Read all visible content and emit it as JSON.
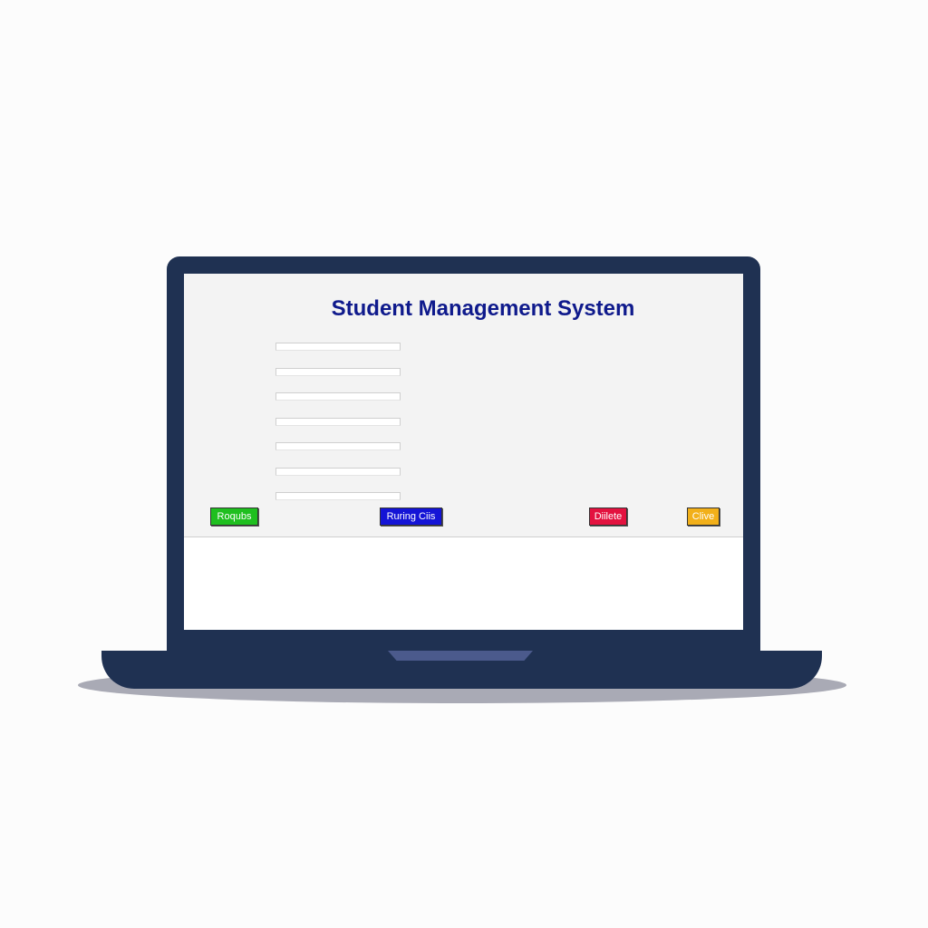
{
  "app": {
    "title": "Student Management System"
  },
  "form": {
    "fields": [
      {
        "value": "",
        "placeholder": ""
      },
      {
        "value": "",
        "placeholder": ""
      },
      {
        "value": "",
        "placeholder": ""
      },
      {
        "value": "",
        "placeholder": ""
      },
      {
        "value": "",
        "placeholder": ""
      },
      {
        "value": "",
        "placeholder": ""
      },
      {
        "value": "",
        "placeholder": ""
      }
    ]
  },
  "buttons": {
    "register": {
      "label": "Roqubs",
      "color": "#1fbf1f"
    },
    "running": {
      "label": "Ruring Ciis",
      "color": "#1414d6"
    },
    "delete": {
      "label": "Diilete",
      "color": "#e3123f"
    },
    "clear": {
      "label": "Clive",
      "color": "#f2b01a"
    }
  },
  "colors": {
    "title": "#0f1a8c",
    "laptop": "#1f3152",
    "panel": "#f3f3f3"
  }
}
